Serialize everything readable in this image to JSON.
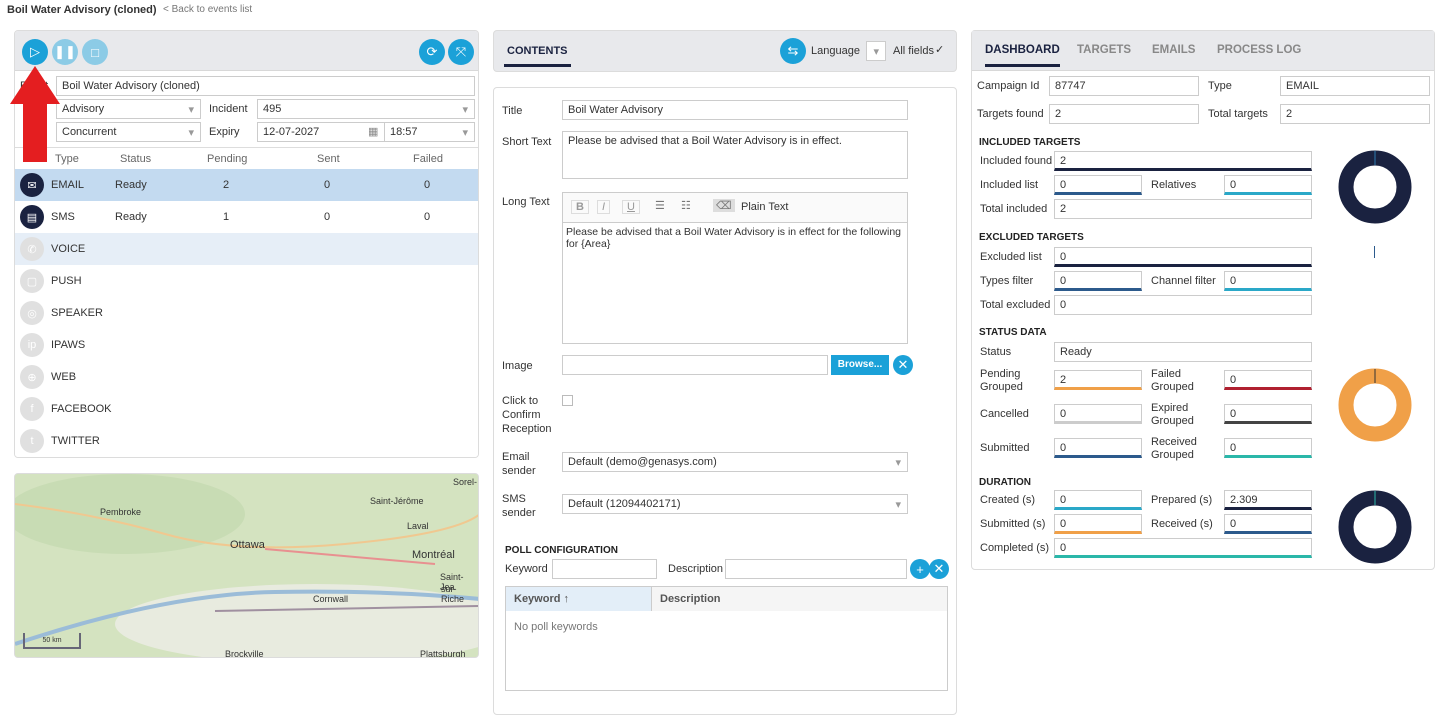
{
  "header": {
    "title": "Boil Water Advisory (cloned)",
    "back_link": "< Back to events list"
  },
  "left": {
    "event_label": "Event",
    "event_value": "Boil Water Advisory (cloned)",
    "type_value": "Advisory",
    "incident_label": "Incident",
    "incident_value": "495",
    "mode_value": "Concurrent",
    "expiry_label": "Expiry",
    "expiry_date": "12-07-2027",
    "expiry_time": "18:57",
    "columns": [
      "Type",
      "Status",
      "Pending",
      "Sent",
      "Failed"
    ],
    "channels": [
      {
        "name": "EMAIL",
        "status": "Ready",
        "pending": "2",
        "sent": "0",
        "failed": "0",
        "icon": "email-icon",
        "active": true
      },
      {
        "name": "SMS",
        "status": "Ready",
        "pending": "1",
        "sent": "0",
        "failed": "0",
        "icon": "sms-icon",
        "active": true
      },
      {
        "name": "VOICE",
        "icon": "phone-icon"
      },
      {
        "name": "PUSH",
        "icon": "push-icon"
      },
      {
        "name": "SPEAKER",
        "icon": "speaker-icon"
      },
      {
        "name": "IPAWS",
        "icon": "ipaws-icon"
      },
      {
        "name": "WEB",
        "icon": "globe-icon"
      },
      {
        "name": "FACEBOOK",
        "icon": "facebook-icon"
      },
      {
        "name": "TWITTER",
        "icon": "twitter-icon"
      }
    ],
    "map": {
      "labels": [
        "Pembroke",
        "Saint-Jérôme",
        "Sorel-",
        "Laval",
        "Ottawa",
        "Montréal",
        "Saint-Jea",
        "sur-Riche",
        "Cornwall",
        "Brockville",
        "Plattsburgh"
      ],
      "scale": "50 km"
    }
  },
  "contents": {
    "tab": "CONTENTS",
    "language_label": "Language",
    "all_fields_label": "All fields",
    "title_label": "Title",
    "title_value": "Boil Water Advisory",
    "short_label": "Short Text",
    "short_value": "Please be advised that a Boil Water Advisory is in effect.",
    "long_label": "Long Text",
    "plain_text": "Plain Text",
    "long_value": "Please be advised that a Boil Water Advisory is in effect for the following for {Area}",
    "image_label": "Image",
    "browse": "Browse...",
    "confirm_label": "Click to Confirm Reception",
    "email_sender_label": "Email sender",
    "email_sender": "Default (demo@genasys.com)",
    "sms_sender_label": "SMS sender",
    "sms_sender": "Default (12094402171)",
    "poll_title": "POLL CONFIGURATION",
    "keyword_label": "Keyword",
    "description_label": "Description",
    "poll_columns": [
      "Keyword",
      "Description"
    ],
    "poll_empty": "No poll keywords"
  },
  "dashboard": {
    "tabs": [
      "DASHBOARD",
      "TARGETS",
      "EMAILS",
      "PROCESS LOG"
    ],
    "campaign_id_label": "Campaign Id",
    "campaign_id": "87747",
    "type_label": "Type",
    "type": "EMAIL",
    "targets_found_label": "Targets found",
    "targets_found": "2",
    "total_targets_label": "Total targets",
    "total_targets": "2",
    "included": {
      "title": "INCLUDED TARGETS",
      "found_label": "Included found",
      "found": "2",
      "list_label": "Included list",
      "list": "0",
      "relatives_label": "Relatives",
      "relatives": "0",
      "total_label": "Total included",
      "total": "2"
    },
    "excluded": {
      "title": "EXCLUDED TARGETS",
      "list_label": "Excluded list",
      "list": "0",
      "types_label": "Types filter",
      "types": "0",
      "channel_label": "Channel filter",
      "channel": "0",
      "total_label": "Total excluded",
      "total": "0"
    },
    "status": {
      "title": "STATUS DATA",
      "status_label": "Status",
      "status": "Ready",
      "pending_label": "Pending Grouped",
      "pending": "2",
      "failed_label": "Failed Grouped",
      "failed": "0",
      "cancelled_label": "Cancelled",
      "cancelled": "0",
      "expired_label": "Expired Grouped",
      "expired": "0",
      "submitted_label": "Submitted",
      "submitted": "0",
      "received_label": "Received Grouped",
      "received": "0"
    },
    "duration": {
      "title": "DURATION",
      "created_label": "Created (s)",
      "created": "0",
      "prepared_label": "Prepared (s)",
      "prepared": "2.309",
      "submitted_label": "Submitted (s)",
      "submitted": "0",
      "received_label": "Received (s)",
      "received": "0",
      "completed_label": "Completed (s)",
      "completed": "0"
    },
    "colors": {
      "navy": "#1a2240",
      "orange": "#f0a048",
      "teal": "#2ab7a9",
      "blue": "#2c5a8c",
      "red": "#b02030",
      "cyan": "#2aa8c8"
    }
  }
}
